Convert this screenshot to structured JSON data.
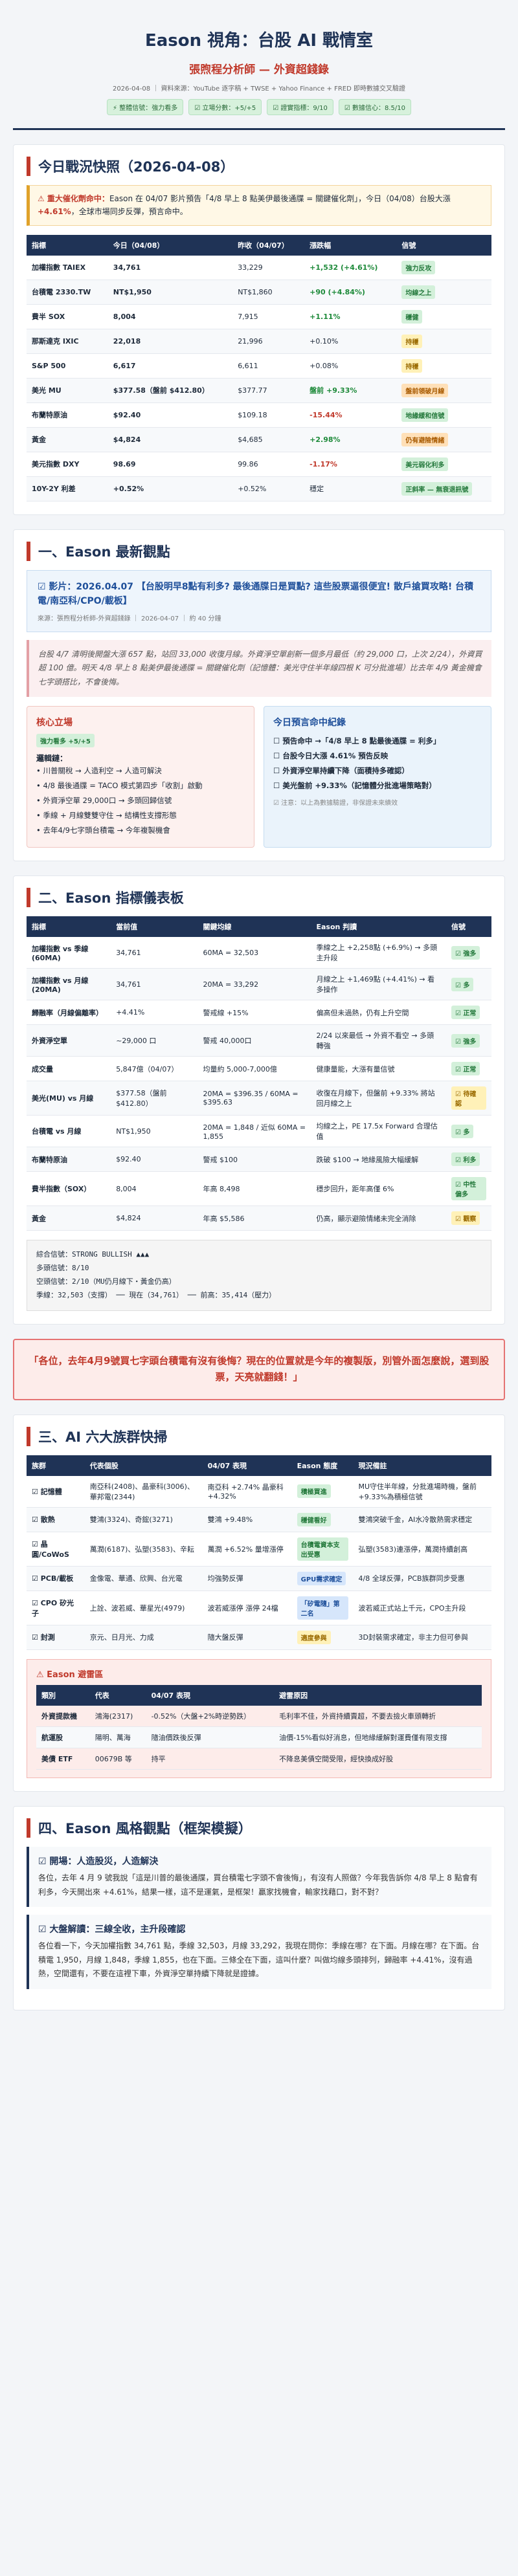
{
  "header": {
    "title": "Eason 視角：台股 AI 戰情室",
    "subtitle": "張煦程分析師 — 外資超錢錄",
    "meta": "2026-04-08 ｜ 資料來源：YouTube 逐字稿 + TWSE + Yahoo Finance + FRED 即時數據交叉驗證",
    "badges": [
      "⚡ 整體信號：強力看多",
      "☑ 立場分數：+5/+5",
      "☑ 證實指標：9/10",
      "☑ 數據信心：8.5/10"
    ]
  },
  "s0": {
    "title": "今日戰況快照（2026-04-08）",
    "alert_prefix": "⚠ 重大催化劑命中：",
    "alert_text": "Eason 在 04/07 影片預告「4/8 早上 8 點美伊最後通牒 = 關鍵催化劑」，今日（04/08）台股大漲 ",
    "alert_pct": "+4.61%",
    "alert_tail": "，全球市場同步反彈，預言命中。",
    "cols": [
      "指標",
      "今日（04/08）",
      "昨收（04/07）",
      "漲跌幅",
      "信號"
    ],
    "rows": [
      [
        "加權指數 TAIEX",
        "34,761",
        "33,229",
        "+1,532 (+4.61%)",
        "強力反攻",
        "up",
        "t-green"
      ],
      [
        "台積電 2330.TW",
        "NT$1,950",
        "NT$1,860",
        "+90 (+4.84%)",
        "均線之上",
        "up",
        "t-green"
      ],
      [
        "費半 SOX",
        "8,004",
        "7,915",
        "+1.11%",
        "穩健",
        "up",
        "t-green"
      ],
      [
        "那斯達克 IXIC",
        "22,018",
        "21,996",
        "+0.10%",
        "持穩",
        "",
        "t-yellow"
      ],
      [
        "S&P 500",
        "6,617",
        "6,611",
        "+0.08%",
        "持穩",
        "",
        "t-yellow"
      ],
      [
        "美光 MU",
        "$377.58（盤前 $412.80）",
        "$377.77",
        "盤前 +9.33%",
        "盤前領破月線",
        "up",
        "t-orange"
      ],
      [
        "布蘭特原油",
        "$92.40",
        "$109.18",
        "-15.44%",
        "地緣緩和信號",
        "down",
        "t-green"
      ],
      [
        "黃金",
        "$4,824",
        "$4,685",
        "+2.98%",
        "仍有避險情緒",
        "up",
        "t-orange"
      ],
      [
        "美元指數 DXY",
        "98.69",
        "99.86",
        "-1.17%",
        "美元弱化利多",
        "down",
        "t-green"
      ],
      [
        "10Y-2Y 利差",
        "+0.52%",
        "+0.52%",
        "穩定",
        "正斜率 — 無衰退訊號",
        "",
        "t-green"
      ]
    ]
  },
  "s1": {
    "title": "一、Eason 最新觀點",
    "q_title": "☑ 影片：2026.04.07 【台股明早8點有利多? 最後通牒日是買點? 這些股票逼很便宜! 散戶搶買攻略! 台積電/南亞科/CPO/載板】",
    "q_meta": "來源：張煦程分析師-外資超錢錄 ｜ 2026-04-07 ｜ 約 40 分鐘",
    "summary": "台股 4/7 清明後開盤大漲 657 點，站回 33,000 收復月線。外資淨空單創新一個多月最低（約 29,000 口，上次 2/24），外資買超 100 億。明天 4/8 早上 8 點美伊最後通牒 = 關鍵催化劑（記憶體：美光守住半年線四根 K 可分批進場）比去年 4/9 黃金機會七字頭搭比，不會後悔。",
    "left_title": "核心立場",
    "left_badge": "強力看多 +5/+5",
    "left_sub": "邏輯鏈：",
    "left_items": [
      "川普關稅 → 人造利空 → 人造可解決",
      "4/8 最後通牒 = TACO 模式第四步「收割」啟動",
      "外資淨空單 29,000口 → 多頭回歸信號",
      "季線 + 月線雙雙守住 → 結構性支撐形態",
      "去年4/9七字頭台積電 → 今年複製機會"
    ],
    "right_title": "今日預言命中紀錄",
    "right_items": [
      "預告命中 →「4/8 早上 8 點最後通牒 = 利多」",
      "台股今日大漲 4.61% 預告反映",
      "外資淨空單持續下降（面積持多確認）",
      "美光盤前 +9.33%（記憶體分批進場策略對）"
    ],
    "right_note": "☑ 注意：以上為數據驗證，非保證未來績效"
  },
  "s2": {
    "title": "二、Eason 指標儀表板",
    "cols": [
      "指標",
      "當前值",
      "關鍵均線",
      "Eason 判讀",
      "信號"
    ],
    "rows": [
      [
        "加權指數 vs 季線 (60MA)",
        "34,761",
        "60MA = 32,503",
        "季線之上 +2,258點 (+6.9%) → 多頭主升段",
        "☑ 強多",
        "t-green"
      ],
      [
        "加權指數 vs 月線 (20MA)",
        "34,761",
        "20MA = 33,292",
        "月線之上 +1,469點 (+4.41%) → 看多操作",
        "☑ 多",
        "t-green"
      ],
      [
        "歸融率（月線偏離率）",
        "+4.41%",
        "警戒線 +15%",
        "偏高但未過熱，仍有上升空間",
        "☑ 正常",
        "t-green"
      ],
      [
        "外資淨空單",
        "~29,000 口",
        "警戒 40,000口",
        "2/24 以來最低 → 外資不看空 → 多頭轉強",
        "☑ 強多",
        "t-green"
      ],
      [
        "成交量",
        "5,847億（04/07）",
        "均量約 5,000-7,000億",
        "健康量能，大漲有量信號",
        "☑ 正常",
        "t-green"
      ],
      [
        "美光(MU) vs 月線",
        "$377.58（盤前 $412.80）",
        "20MA = $396.35 / 60MA = $395.63",
        "收復在月線下，但盤前 +9.33% 將站回月線之上",
        "☑ 待確認",
        "t-yellow"
      ],
      [
        "台積電 vs 月線",
        "NT$1,950",
        "20MA = 1,848 / 近似 60MA = 1,855",
        "均線之上，PE 17.5x Forward 合理估值",
        "☑ 多",
        "t-green"
      ],
      [
        "布蘭特原油",
        "$92.40",
        "警戒 $100",
        "跌破 $100 → 地緣風險大幅緩解",
        "☑ 利多",
        "t-green"
      ],
      [
        "費半指數（SOX）",
        "8,004",
        "年高 8,498",
        "穩步回升，距年高僅 6%",
        "☑ 中性偏多",
        "t-green"
      ],
      [
        "黃金",
        "$4,824",
        "年高 $5,586",
        "仍高，顯示避險情緒未完全消除",
        "☑ 觀察",
        "t-yellow"
      ]
    ],
    "mono": [
      "綜合信號：STRONG BULLISH ▲▲▲",
      "多頭信號：8/10",
      "空頭信號：2/10（MU仍月線下・黃金仍高）",
      "季線：32,503（支撐） ── 現在（34,761） ── 前高：35,414（壓力）"
    ]
  },
  "callout": "「各位，去年4月9號買七字頭台積電有沒有後悔？現在的位置就是今年的複製版，別管外面怎麼說，選到股票，天亮就翻錢！」",
  "s3": {
    "title": "三、AI 六大族群快掃",
    "cols": [
      "族群",
      "代表個股",
      "04/07 表現",
      "Eason 態度",
      "現況備註"
    ],
    "rows": [
      [
        "☑ 記憶體",
        "南亞科(2408)、晶豪科(3006)、華邦電(2344)",
        "南亞科 +2.74% 晶豪科 +4.32%",
        "積極買進",
        "MU守住半年線，分批進場時機，盤前+9.33%為積極信號",
        "t-green"
      ],
      [
        "☑ 散熱",
        "雙鴻(3324)、奇鋐(3271)",
        "雙鴻 +9.48%",
        "穩健看好",
        "雙鴻突破千金，AI水冷散熱需求穩定",
        "t-green"
      ],
      [
        "☑ 晶圓/CoWoS",
        "萬潤(6187)、弘塑(3583)、辛耘",
        "萬潤 +6.52% 量增漲停",
        "台積電資本支出受惠",
        "弘塑(3583)連漲停，萬潤持續創高",
        "t-green"
      ],
      [
        "☑ PCB/載板",
        "金像電、華通、欣興、台光電",
        "均強勢反彈",
        "GPU需求確定",
        "4/8 全球反彈，PCB族群同步受惠",
        "t-blue"
      ],
      [
        "☑ CPO 矽光子",
        "上詮、波若威、華星光(4979)",
        "波若威漲停 漲停 24檔",
        "「矽電隨」第二名",
        "波若威正式站上千元，CPO主升段",
        "t-blue"
      ],
      [
        "☑ 封測",
        "京元、日月光、力成",
        "隨大盤反彈",
        "適度參與",
        "3D封裝需求確定，非主力但可參與",
        "t-yellow"
      ]
    ],
    "warn_title": "⚠ Eason 避雷區",
    "warn_cols": [
      "類別",
      "代表",
      "04/07 表現",
      "避雷原因"
    ],
    "warn_rows": [
      [
        "外資提款機",
        "鴻海(2317)",
        "-0.52%（大盤+2%時逆勢跌）",
        "毛利率不佳，外資持續賣超，不要去撿火車頭轉折"
      ],
      [
        "航運股",
        "陽明、萬海",
        "隨油價跌後反彈",
        "油價-15%看似好消息，但地緣緩解對運費僅有限支撐"
      ],
      [
        "美債 ETF",
        "00679B 等",
        "持平",
        "不降息美債空間受限，經快換成好股"
      ]
    ]
  },
  "s4": {
    "title": "四、Eason 風格觀點（框架模擬）",
    "cards": [
      {
        "h": "☑ 開場：人造股災，人造解決",
        "p": "各位，去年 4 月 9 號我說「這是川普的最後通牒，買台積電七字頭不會後悔」，有沒有人照做？今年我告訴你 4/8 早上 8 點會有利多，今天開出來 +4.61%，結果一樣，這不是運氣，是框架！贏家找機會，輸家找藉口，對不對？"
      },
      {
        "h": "☑ 大盤解讀：三線全收，主升段確認",
        "p": "各位看一下，今天加權指數 34,761 點，季線 32,503，月線 33,292，我現在問你：季線在哪？在下面。月線在哪？在下面。台積電 1,950，月線 1,848，季線 1,855，也在下面。三條全在下面，這叫什麼？叫做均線多頭排列，歸融率 +4.41%，沒有過熱，空間還有，不要在這裡下車，外資淨空單持續下降就是證據。"
      }
    ]
  }
}
